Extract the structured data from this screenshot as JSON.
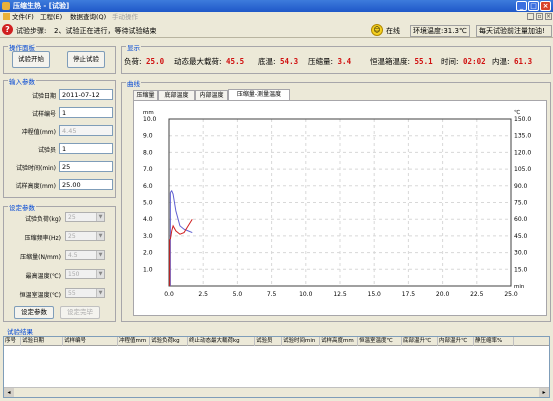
{
  "window": {
    "title": "压缩生热 - [试验]"
  },
  "menu": {
    "file": "文件(F)",
    "project": "工程(E)",
    "query": "数据查询(Q)",
    "manual": "手动操作"
  },
  "status": {
    "step_label": "试验步骤:",
    "step_text": "2、试验正在进行，等待试验结束",
    "online": "在线",
    "ambient": "环境温度:31.3℃",
    "notice": "每天试验前注量加油!"
  },
  "op_panel": {
    "title": "操作面板",
    "start": "试验开始",
    "stop": "停止试验"
  },
  "display": {
    "title": "显示",
    "items": [
      {
        "label": "负荷:",
        "value": "25.0"
      },
      {
        "label": "动态最大载荷:",
        "value": "45.5"
      },
      {
        "label": "底温:",
        "value": "54.3"
      },
      {
        "label": "压缩量:",
        "value": "3.4"
      },
      {
        "label": "恒温箱温度:",
        "value": "55.1"
      },
      {
        "label": "时间:",
        "value": "02:02"
      },
      {
        "label": "内温:",
        "value": "61.3"
      }
    ]
  },
  "input_params": {
    "title": "输入参数",
    "fields": [
      {
        "label": "试验日期",
        "value": "2011-07-12"
      },
      {
        "label": "试样编号",
        "value": "1"
      },
      {
        "label": "冲程值(mm)",
        "value": "4.45"
      },
      {
        "label": "试验员",
        "value": "1"
      },
      {
        "label": "试验时间(min)",
        "value": "25"
      },
      {
        "label": "试样高度(mm)",
        "value": "25.00"
      }
    ]
  },
  "set_params": {
    "title": "设定参数",
    "fields": [
      {
        "label": "试验负荷(kg)",
        "value": "25"
      },
      {
        "label": "压缩频率(Hz)",
        "value": "25"
      },
      {
        "label": "压缩量(N/mm)",
        "value": "4.5"
      },
      {
        "label": "最高温度(℃)",
        "value": "150"
      },
      {
        "label": "恒温室温度(℃)",
        "value": "55"
      }
    ],
    "set_btn": "设定参数",
    "done_btn": "设定完毕"
  },
  "curves": {
    "title": "曲线",
    "tabs": [
      "压缩量",
      "底部温度",
      "内部温度",
      "压缩量-测量温度"
    ],
    "active_tab": 3
  },
  "chart_data": {
    "type": "line",
    "x": [
      0.1,
      0.2,
      0.3,
      0.5,
      0.8,
      1.1,
      1.4,
      1.7
    ],
    "y_left_unit": "mm",
    "y_right_unit": "℃",
    "x_right_label": "min",
    "xlim": [
      0,
      25
    ],
    "ylim_left": [
      0,
      10
    ],
    "ylim_right": [
      0,
      150
    ],
    "x_ticks": [
      "0.0",
      "2.5",
      "5.0",
      "7.5",
      "10.0",
      "12.5",
      "15.0",
      "17.5",
      "20.0",
      "22.5",
      "25.0"
    ],
    "yl_ticks": [
      "10.0",
      "9.0",
      "8.0",
      "7.0",
      "6.0",
      "5.0",
      "4.0",
      "3.0",
      "2.0",
      "1.0"
    ],
    "yr_ticks": [
      "150.0",
      "135.0",
      "120.0",
      "105.0",
      "90.0",
      "75.0",
      "60.0",
      "45.0",
      "30.0",
      "15.0"
    ],
    "series": [
      {
        "values": [
          5.6,
          5.7,
          5.5,
          4.5,
          3.6,
          3.4,
          3.3,
          3.2
        ],
        "color": "#6060d0"
      },
      {
        "values": [
          2.8,
          3.3,
          3.6,
          3.3,
          3.1,
          3.2,
          3.6,
          4.0
        ],
        "color": "#d02020"
      }
    ],
    "grid": true
  },
  "results": {
    "title": "试验结果",
    "columns": [
      "序号",
      "试验日期",
      "试样编号",
      "冲程值mm",
      "试验负荷kg",
      "终止动态最大载荷kg",
      "试验员",
      "试验时间min",
      "试样高度mm",
      "恒温室温度℃",
      "底部温升℃",
      "内部温升℃",
      "静压缩率%"
    ]
  }
}
